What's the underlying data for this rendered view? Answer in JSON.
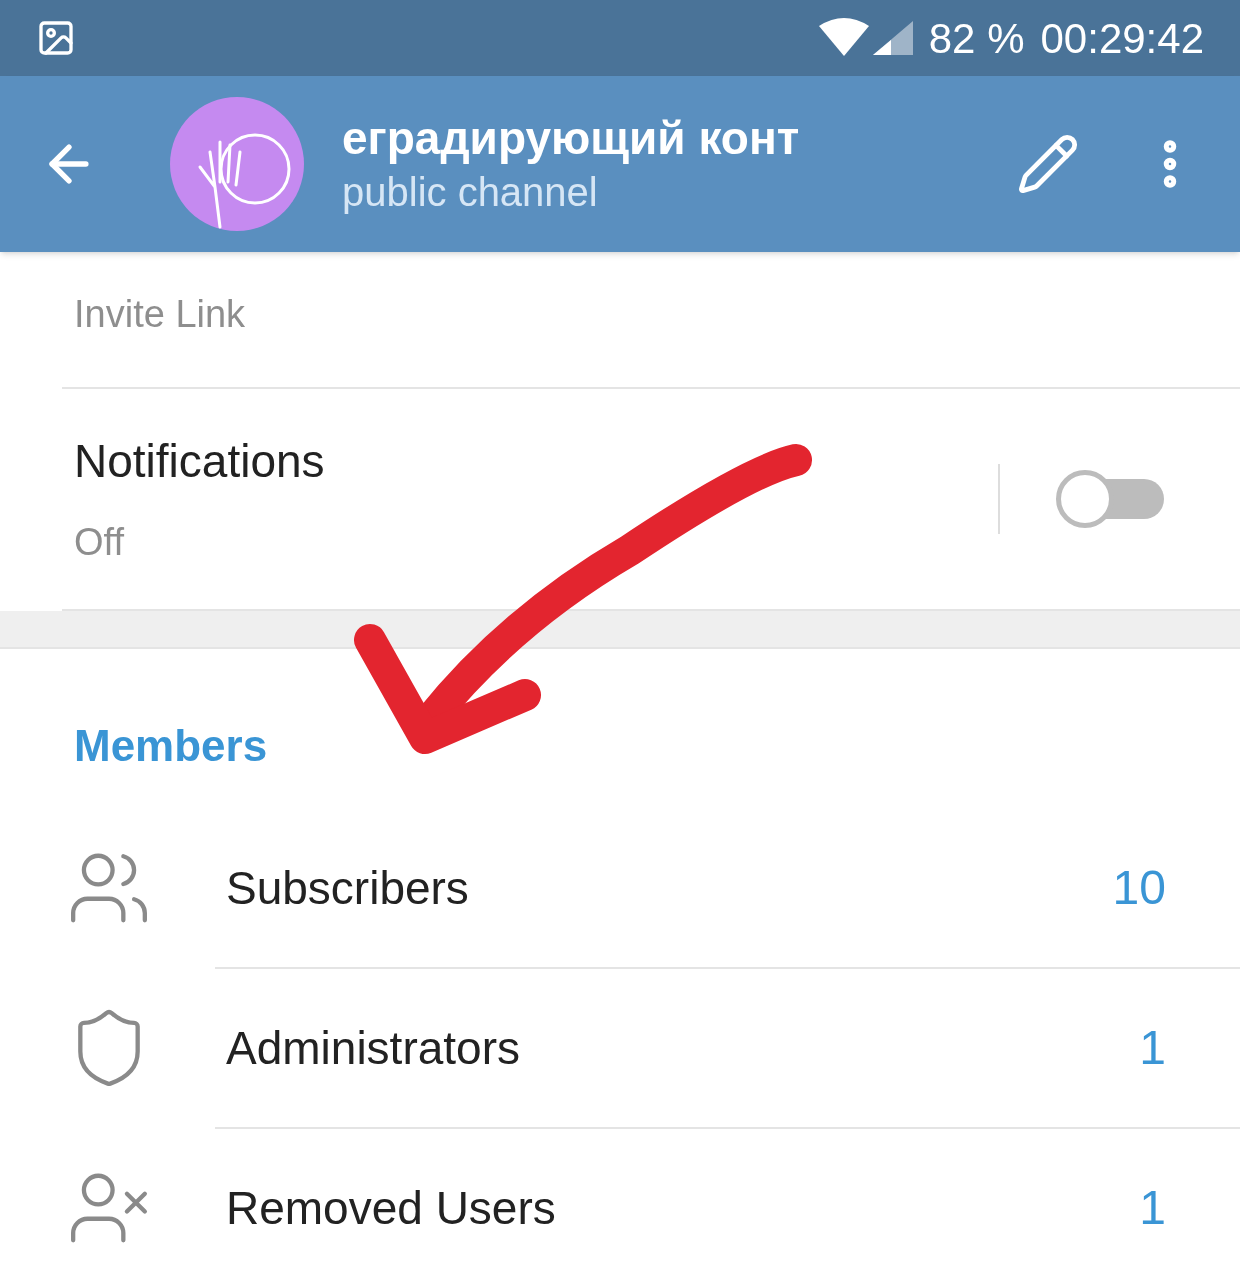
{
  "status_bar": {
    "battery": "82 %",
    "time": "00:29:42"
  },
  "header": {
    "title": "еградирующий конт",
    "subtitle": "public channel"
  },
  "invite": {
    "label": "Invite Link"
  },
  "notifications": {
    "title": "Notifications",
    "value": "Off",
    "on": false
  },
  "members": {
    "title": "Members",
    "rows": [
      {
        "kind": "subscribers",
        "label": "Subscribers",
        "count": "10"
      },
      {
        "kind": "admins",
        "label": "Administrators",
        "count": "1"
      },
      {
        "kind": "removed",
        "label": "Removed Users",
        "count": "1"
      }
    ]
  }
}
